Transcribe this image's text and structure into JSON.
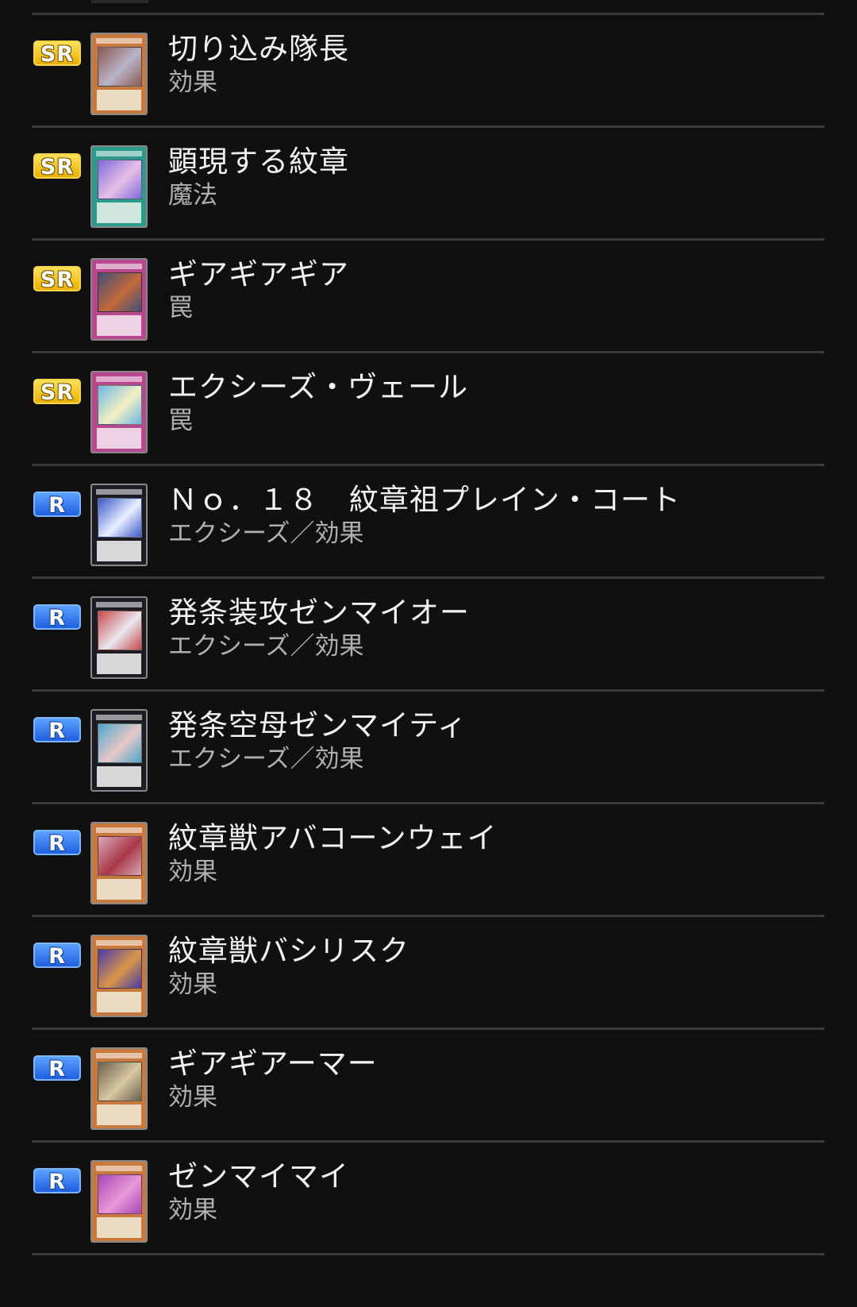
{
  "cards": [
    {
      "rarity": "SR",
      "name": "切り込み隊長",
      "type": "効果",
      "frame": "effect",
      "art": [
        "#8a5a52",
        "#b8b4c8"
      ]
    },
    {
      "rarity": "SR",
      "name": "顕現する紋章",
      "type": "魔法",
      "frame": "spell",
      "art": [
        "#7d6ad8",
        "#e7c0e8"
      ]
    },
    {
      "rarity": "SR",
      "name": "ギアギアギア",
      "type": "罠",
      "frame": "trap",
      "art": [
        "#3e4e7a",
        "#c46a3a"
      ]
    },
    {
      "rarity": "SR",
      "name": "エクシーズ・ヴェール",
      "type": "罠",
      "frame": "trap",
      "art": [
        "#6ab8e8",
        "#f4f0c0"
      ]
    },
    {
      "rarity": "R",
      "name": "Ｎｏ．１８　紋章祖プレイン・コート",
      "type": "エクシーズ／効果",
      "frame": "xyz",
      "art": [
        "#3a58c8",
        "#e8f0ff"
      ]
    },
    {
      "rarity": "R",
      "name": "発条装攻ゼンマイオー",
      "type": "エクシーズ／効果",
      "frame": "xyz",
      "art": [
        "#c84848",
        "#e8e8f0"
      ]
    },
    {
      "rarity": "R",
      "name": "発条空母ゼンマイティ",
      "type": "エクシーズ／効果",
      "frame": "xyz",
      "art": [
        "#4aa8c8",
        "#e8c8c8"
      ]
    },
    {
      "rarity": "R",
      "name": "紋章獣アバコーンウェイ",
      "type": "効果",
      "frame": "effect",
      "art": [
        "#d8a8b8",
        "#a83848"
      ]
    },
    {
      "rarity": "R",
      "name": "紋章獣バシリスク",
      "type": "効果",
      "frame": "effect",
      "art": [
        "#4838a8",
        "#d89848"
      ]
    },
    {
      "rarity": "R",
      "name": "ギアギアーマー",
      "type": "効果",
      "frame": "effect",
      "art": [
        "#6a6050",
        "#d8c8a0"
      ]
    },
    {
      "rarity": "R",
      "name": "ゼンマイマイ",
      "type": "効果",
      "frame": "effect",
      "art": [
        "#a848b8",
        "#e898d8"
      ]
    }
  ],
  "colors": {
    "background": "#101010",
    "divider": "#3b3b3b",
    "title": "#f2f2f2",
    "subtitle": "#b0b0b0",
    "frame_effect": "#c87a3e",
    "frame_spell": "#2a9a8a",
    "frame_trap": "#b8488e",
    "frame_xyz": "#1c1c22"
  }
}
